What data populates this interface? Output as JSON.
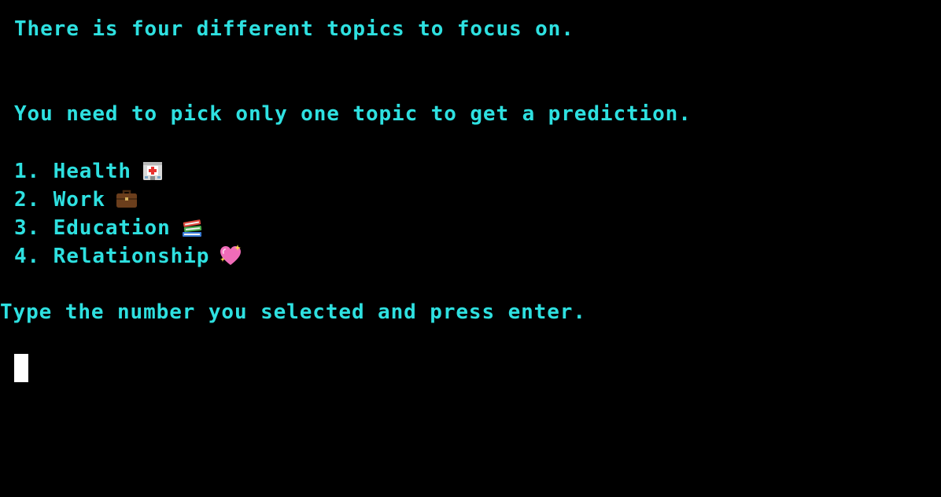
{
  "terminal": {
    "intro": "There is four different topics to focus on.",
    "instruction": "You need to pick only one topic to get a prediction.",
    "options": [
      {
        "label": "1. Health",
        "icon": "hospital-icon"
      },
      {
        "label": "2. Work",
        "icon": "briefcase-icon"
      },
      {
        "label": "3. Education",
        "icon": "books-icon"
      },
      {
        "label": "4. Relationship",
        "icon": "sparkling-heart-icon"
      }
    ],
    "prompt": "Type the number you selected and press enter.",
    "input_value": ""
  },
  "colors": {
    "background": "#000000",
    "text": "#2ee0e0",
    "cursor": "#ffffff"
  }
}
